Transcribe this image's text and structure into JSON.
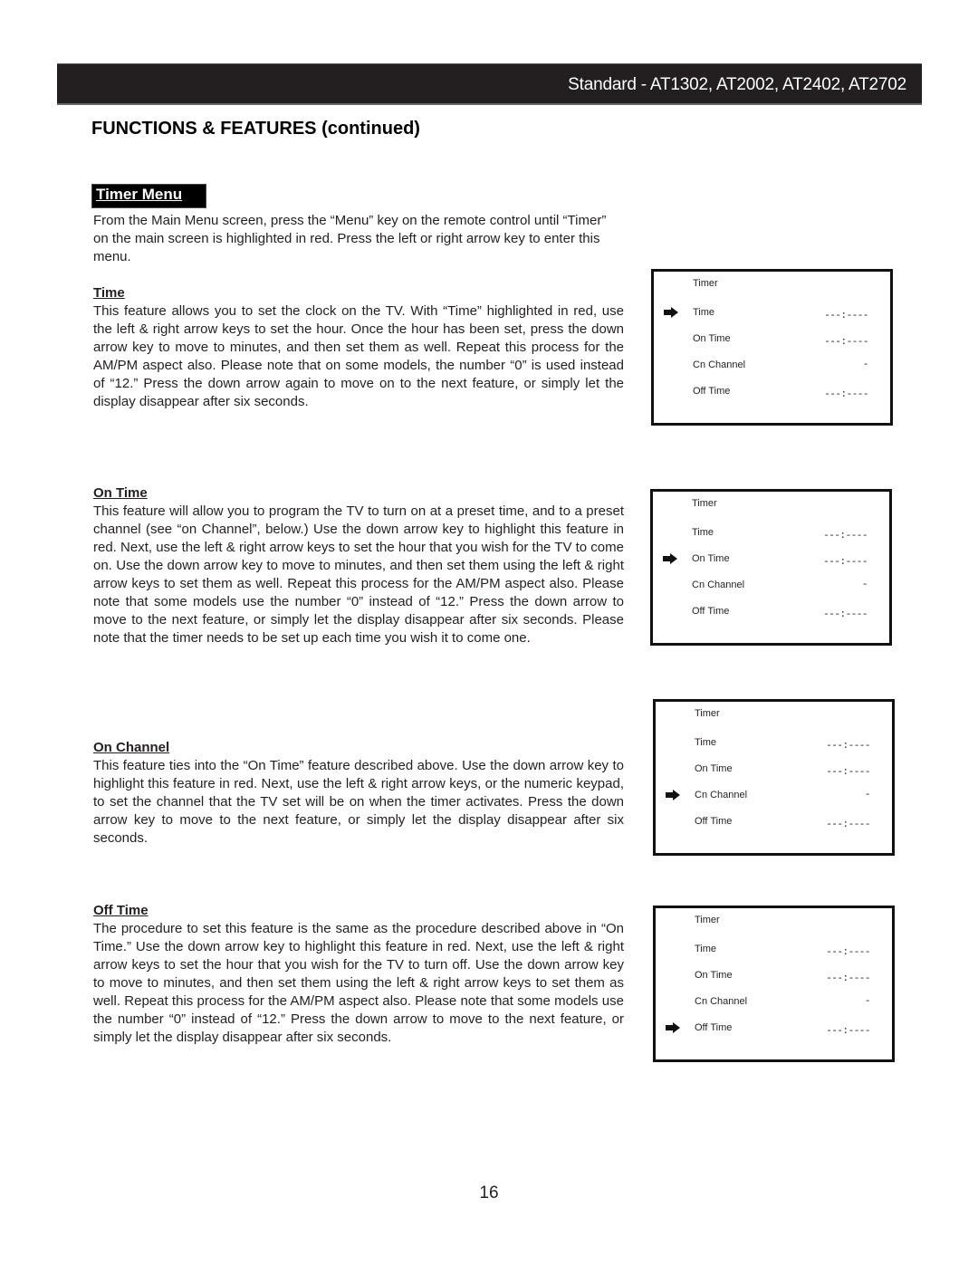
{
  "header": {
    "model_title": "Standard - AT1302, AT2002, AT2402, AT2702"
  },
  "page_heading": "FUNCTIONS & FEATURES (continued)",
  "section_tag": "Timer Menu",
  "intro": "From the Main Menu screen, press the “Menu” key on the remote control until “Timer” on the main screen is highlighted in red. Press the left or right arrow key to enter this menu.",
  "sections": [
    {
      "heading": "Time",
      "body": "This feature allows you to set the clock on the TV. With “Time” highlighted in red, use the left & right arrow keys to set the hour. Once the hour has been set, press the down arrow key to move to minutes, and then set them as well. Repeat this process for the AM/PM aspect also. Please note that on some models, the number “0” is used instead of “12.” Press the down arrow again to move on to the next feature, or simply let the display disappear after six seconds."
    },
    {
      "heading": "On Time",
      "body": "This feature will allow you to program the TV to turn on at a preset time, and to a preset channel (see “on Channel”, below.) Use the down arrow key to highlight this feature in red. Next, use the left & right arrow keys to set the hour that you wish for the TV to come on. Use the down arrow key to move to minutes, and then set them using the left & right arrow keys to set them as well. Repeat this process for the AM/PM aspect also. Please note that some models use the number “0” instead of “12.” Press the down arrow to move to the next feature, or simply let the display disappear after six seconds. Please note that the timer needs to be set up each time you wish it to come one."
    },
    {
      "heading": "On Channel",
      "body": "This feature ties into the “On Time” feature described above. Use the down arrow key to highlight this feature in red. Next, use the left & right arrow keys, or the numeric keypad, to set the channel that the TV set will be on when the timer activates. Press the down arrow key to move to the next feature, or simply let the display disappear after six seconds."
    },
    {
      "heading": "Off Time",
      "body": "The procedure to set this feature is the same as the procedure described above in “On Time.” Use the down arrow key to highlight this feature in red. Next, use the left & right arrow keys to set the hour that you wish for the TV to turn off. Use the down arrow key to move to minutes, and then set them using the left & right arrow keys to set them as well. Repeat this process for the AM/PM aspect also. Please note that some models use the number “0” instead of “12.” Press the down arrow to move to the next feature, or simply let the display disappear after six seconds."
    }
  ],
  "osd": {
    "title": "Timer",
    "items": [
      {
        "label": "Time",
        "value": "---:----"
      },
      {
        "label": "On Time",
        "value": "---:----"
      },
      {
        "label": "Cn Channel",
        "value": "-"
      },
      {
        "label": "Off Time",
        "value": "---:----"
      }
    ],
    "selector_icon": "right-arrow-icon",
    "screens": [
      {
        "selected_index": 0
      },
      {
        "selected_index": 1
      },
      {
        "selected_index": 2
      },
      {
        "selected_index": 3
      }
    ]
  },
  "page_number": "16"
}
